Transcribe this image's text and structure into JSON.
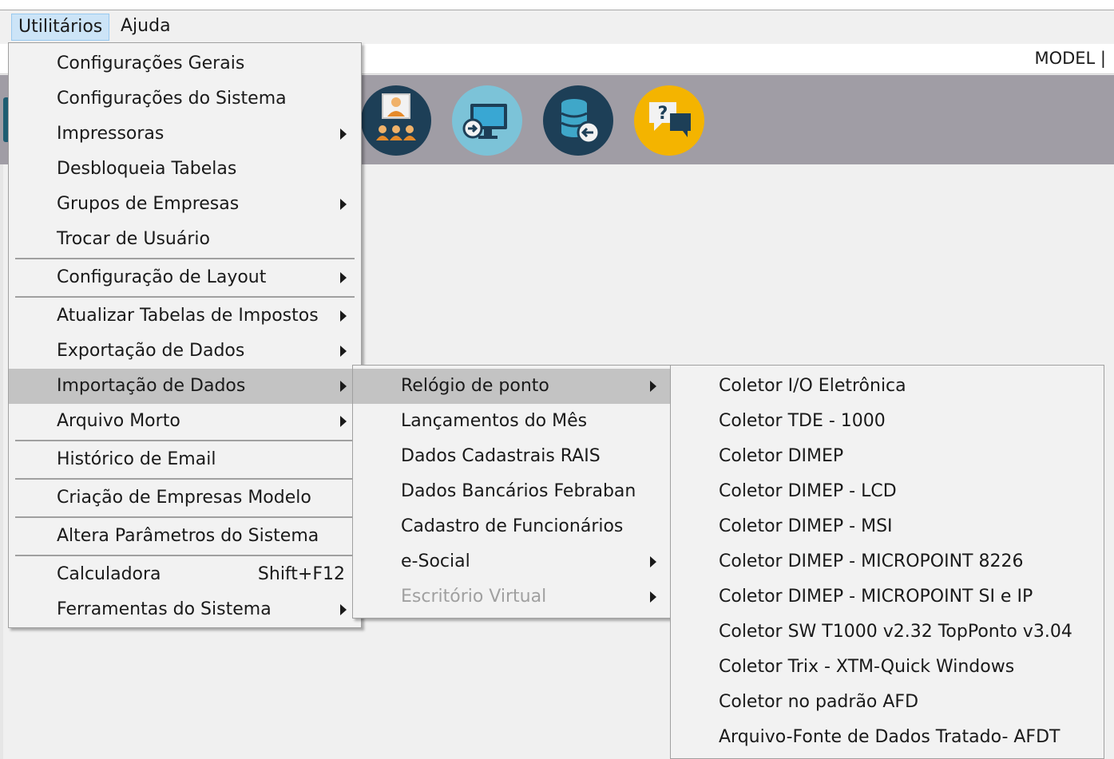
{
  "menubar": {
    "items": [
      "Utilitários",
      "Ajuda"
    ]
  },
  "model_label": "MODEL |",
  "toolbar": {
    "icons": [
      "users-icon",
      "remote-desktop-icon",
      "database-restore-icon",
      "help-chat-icon"
    ]
  },
  "menu_main": {
    "items": [
      {
        "label": "Configurações Gerais"
      },
      {
        "label": "Configurações do Sistema"
      },
      {
        "label": "Impressoras"
      },
      {
        "label": "Desbloqueia Tabelas"
      },
      {
        "label": "Grupos de Empresas"
      },
      {
        "label": "Trocar de Usuário"
      },
      {
        "label": "Configuração de Layout"
      },
      {
        "label": "Atualizar Tabelas de Impostos"
      },
      {
        "label": "Exportação de Dados"
      },
      {
        "label": "Importação de Dados"
      },
      {
        "label": "Arquivo Morto"
      },
      {
        "label": "Histórico de Email"
      },
      {
        "label": "Criação de Empresas Modelo"
      },
      {
        "label": "Altera Parâmetros do Sistema"
      },
      {
        "label": "Calculadora",
        "shortcut": "Shift+F12"
      },
      {
        "label": "Ferramentas do Sistema"
      }
    ]
  },
  "menu_import": {
    "items": [
      {
        "label": "Relógio de ponto"
      },
      {
        "label": "Lançamentos do Mês"
      },
      {
        "label": "Dados Cadastrais RAIS"
      },
      {
        "label": "Dados Bancários Febraban"
      },
      {
        "label": "Cadastro de Funcionários"
      },
      {
        "label": "e-Social"
      },
      {
        "label": "Escritório Virtual"
      }
    ]
  },
  "menu_clock": {
    "items": [
      {
        "label": "Coletor I/O Eletrônica"
      },
      {
        "label": "Coletor TDE - 1000"
      },
      {
        "label": "Coletor DIMEP"
      },
      {
        "label": "Coletor DIMEP - LCD"
      },
      {
        "label": "Coletor DIMEP - MSI"
      },
      {
        "label": "Coletor DIMEP - MICROPOINT 8226"
      },
      {
        "label": "Coletor DIMEP - MICROPOINT SI e IP"
      },
      {
        "label": "Coletor SW T1000 v2.32 TopPonto v3.04"
      },
      {
        "label": "Coletor Trix - XTM-Quick Windows"
      },
      {
        "label": "Coletor no padrão AFD"
      },
      {
        "label": "Arquivo-Fonte de Dados Tratado- AFDT"
      }
    ]
  }
}
